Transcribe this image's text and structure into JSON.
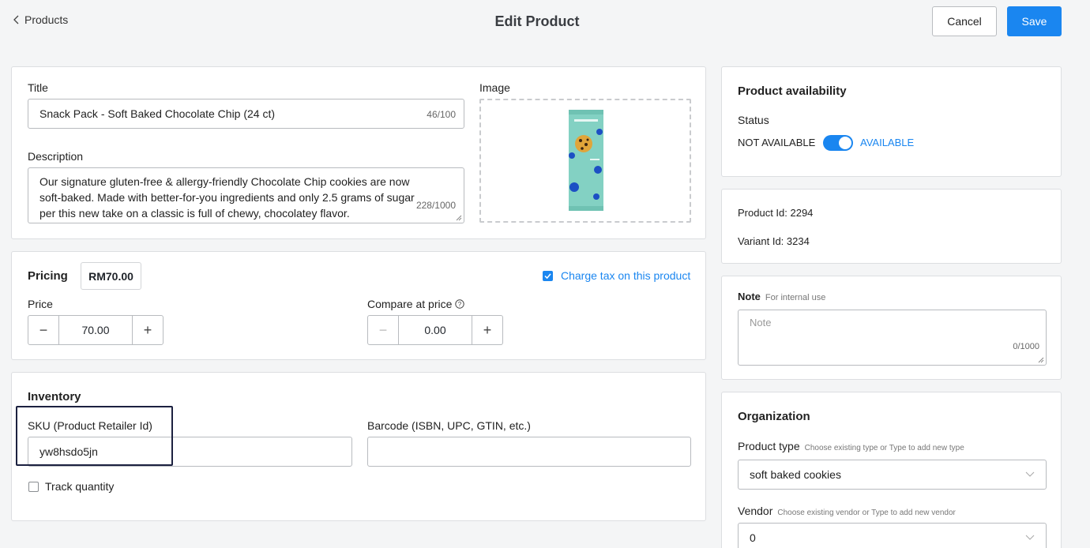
{
  "header": {
    "back_label": "Products",
    "title": "Edit Product",
    "cancel_label": "Cancel",
    "save_label": "Save"
  },
  "product": {
    "title_label": "Title",
    "title_value": "Snack Pack - Soft Baked Chocolate Chip (24 ct)",
    "title_counter": "46/100",
    "description_label": "Description",
    "description_value": "Our signature gluten-free & allergy-friendly Chocolate Chip cookies are now soft-baked. Made with better-for-you ingredients and only 2.5 grams of sugar per this new take on a classic is full of chewy, chocolatey flavor.",
    "description_counter": "228/1000",
    "image_label": "Image",
    "image_colors": {
      "pack": "#7fcfc0",
      "accent": "#1c4fc4"
    }
  },
  "pricing": {
    "label": "Pricing",
    "display_price": "RM70.00",
    "charge_tax_label": "Charge tax on this product",
    "charge_tax_checked": true,
    "price_label": "Price",
    "price_value": "70.00",
    "compare_label": "Compare at price",
    "compare_value": "0.00"
  },
  "inventory": {
    "label": "Inventory",
    "sku_label": "SKU (Product Retailer Id)",
    "sku_value": "yw8hsdo5jn",
    "barcode_label": "Barcode (ISBN, UPC, GTIN, etc.)",
    "barcode_value": "",
    "track_quantity_label": "Track quantity",
    "track_quantity_checked": false
  },
  "availability": {
    "heading": "Product availability",
    "status_label": "Status",
    "not_available_label": "NOT AVAILABLE",
    "available_label": "AVAILABLE",
    "is_available": true
  },
  "ids": {
    "product_id": "Product Id: 2294",
    "variant_id": "Variant Id: 3234"
  },
  "note": {
    "label": "Note",
    "hint": "For internal use",
    "placeholder": "Note",
    "counter": "0/1000"
  },
  "organization": {
    "heading": "Organization",
    "product_type_label": "Product type",
    "product_type_hint": "Choose existing type or Type to add new type",
    "product_type_value": "soft baked cookies",
    "vendor_label": "Vendor",
    "vendor_hint": "Choose existing vendor or Type to add new vendor",
    "vendor_value": "0"
  },
  "colors": {
    "accent": "#1a86f0",
    "highlight_border": "#1c2140"
  },
  "icons": [
    "chevron-left-icon",
    "checkmark-icon",
    "help-circle-icon",
    "minus-icon",
    "plus-icon",
    "chevron-down-icon"
  ]
}
